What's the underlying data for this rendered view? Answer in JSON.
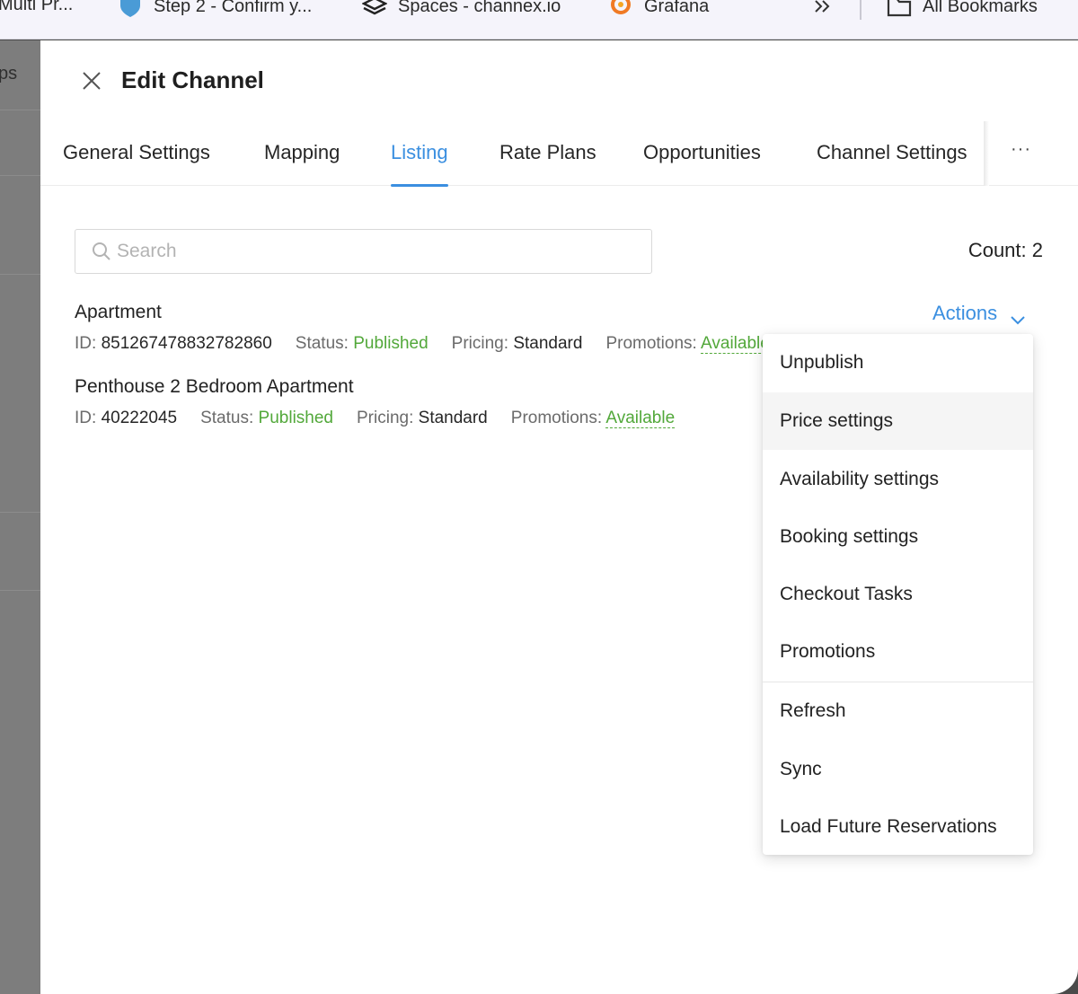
{
  "bookmarks": {
    "items": [
      {
        "label": "Multi Pr...",
        "icon": "page-icon"
      },
      {
        "label": "Step 2 - Confirm y...",
        "icon": "shield-icon"
      },
      {
        "label": "Spaces - channex.io",
        "icon": "stack-icon"
      },
      {
        "label": "Grafana",
        "icon": "grafana-icon"
      }
    ],
    "overflow_icon": "double-chevron-right-icon",
    "all_bookmarks": "All Bookmarks"
  },
  "backdrop": {
    "partial_text": "ps"
  },
  "drawer": {
    "title": "Edit Channel",
    "close_icon": "close-icon",
    "tabs": [
      {
        "label": "General Settings",
        "active": false
      },
      {
        "label": "Mapping",
        "active": false
      },
      {
        "label": "Listing",
        "active": true
      },
      {
        "label": "Rate Plans",
        "active": false
      },
      {
        "label": "Opportunities",
        "active": false
      },
      {
        "label": "Channel Settings",
        "active": false
      }
    ],
    "more_tabs": "···"
  },
  "search": {
    "placeholder": "Search",
    "value": ""
  },
  "count": {
    "label": "Count:",
    "value": "2",
    "text": "Count: 2"
  },
  "listings": [
    {
      "name": "Apartment",
      "id_label": "ID:",
      "id": "851267478832782860",
      "status_label": "Status:",
      "status": "Published",
      "pricing_label": "Pricing:",
      "pricing": "Standard",
      "promotions_label": "Promotions:",
      "promotions": "Available"
    },
    {
      "name": "Penthouse 2 Bedroom Apartment",
      "id_label": "ID:",
      "id": "40222045",
      "status_label": "Status:",
      "status": "Published",
      "pricing_label": "Pricing:",
      "pricing": "Standard",
      "promotions_label": "Promotions:",
      "promotions": "Available"
    }
  ],
  "actions": {
    "label": "Actions",
    "menu": [
      {
        "label": "Unpublish"
      },
      {
        "label": "Price settings",
        "hovered": true
      },
      {
        "label": "Availability settings"
      },
      {
        "label": "Booking settings"
      },
      {
        "label": "Checkout Tasks"
      },
      {
        "label": "Promotions"
      },
      {
        "label": "Refresh"
      },
      {
        "label": "Sync"
      },
      {
        "label": "Load Future Reservations"
      }
    ]
  },
  "colors": {
    "accent": "#3b8fe0",
    "status_green": "#52a83a",
    "backdrop": "#7d7d7d"
  }
}
